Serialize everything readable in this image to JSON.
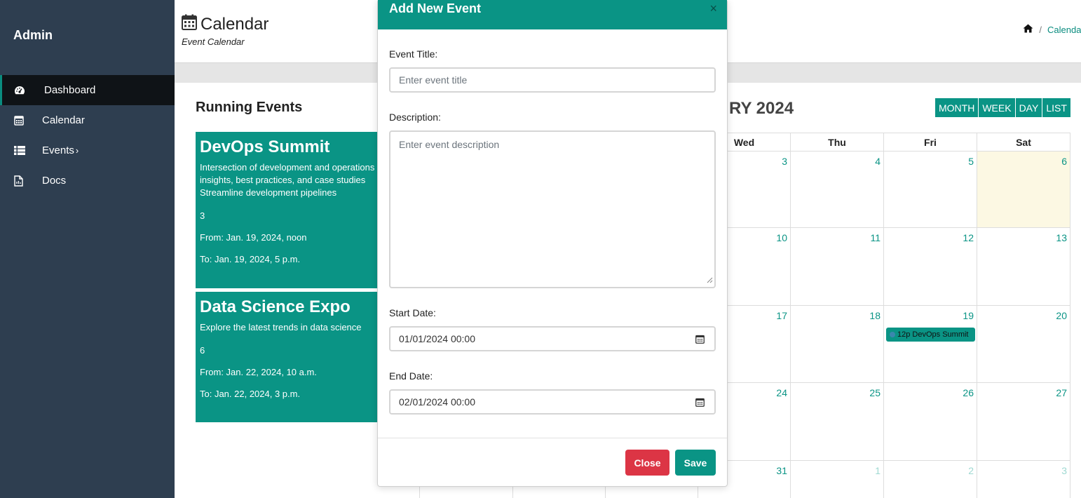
{
  "sidebar": {
    "brand": "Admin",
    "items": [
      {
        "label": "Dashboard",
        "icon": "dashboard-icon",
        "active": true
      },
      {
        "label": "Calendar",
        "icon": "calendar-icon"
      },
      {
        "label": "Events",
        "icon": "list-icon",
        "chevron": "›"
      },
      {
        "label": "Docs",
        "icon": "document-icon"
      }
    ]
  },
  "header": {
    "title": "Calendar",
    "subtitle": "Event Calendar",
    "breadcrumb": {
      "separator": "/",
      "current": "Calendar"
    }
  },
  "running": {
    "title": "Running Events",
    "events": [
      {
        "title": "DevOps Summit",
        "description": "Intersection of development and operations Industry insights, best practices, and case studies Streamline development pipelines",
        "count": "3",
        "from": "From: Jan. 19, 2024, noon",
        "to": "To: Jan. 19, 2024, 5 p.m."
      },
      {
        "title": "Data Science Expo",
        "description": "Explore the latest trends in data science",
        "count": "6",
        "from": "From: Jan. 22, 2024, 10 a.m.",
        "to": "To: Jan. 22, 2024, 3 p.m."
      }
    ]
  },
  "calendar": {
    "title": "RY 2024",
    "views": [
      "MONTH",
      "WEEK",
      "DAY",
      "LIST"
    ],
    "days": [
      "Wed",
      "Thu",
      "Fri",
      "Sat"
    ],
    "weeks": [
      [
        "3",
        "4",
        "5",
        "6"
      ],
      [
        "10",
        "11",
        "12",
        "13"
      ],
      [
        "17",
        "18",
        "19",
        "20"
      ],
      [
        "24",
        "25",
        "26",
        "27"
      ],
      [
        "31",
        "1",
        "2",
        "3"
      ]
    ],
    "event": {
      "label": "12p DevOps Summit"
    }
  },
  "modal": {
    "title": "Add New Event",
    "close_symbol": "×",
    "event_title_label": "Event Title:",
    "event_title_placeholder": "Enter event title",
    "description_label": "Description:",
    "description_placeholder": "Enter event description",
    "start_label": "Start Date:",
    "start_value": "01/01/2024 00:00",
    "end_label": "End Date:",
    "end_value": "02/01/2024 00:00",
    "close_label": "Close",
    "save_label": "Save"
  },
  "colors": {
    "accent": "#0a9485",
    "sidebar": "#2e3e50",
    "danger": "#dc3545",
    "today": "#fcf8e3"
  }
}
